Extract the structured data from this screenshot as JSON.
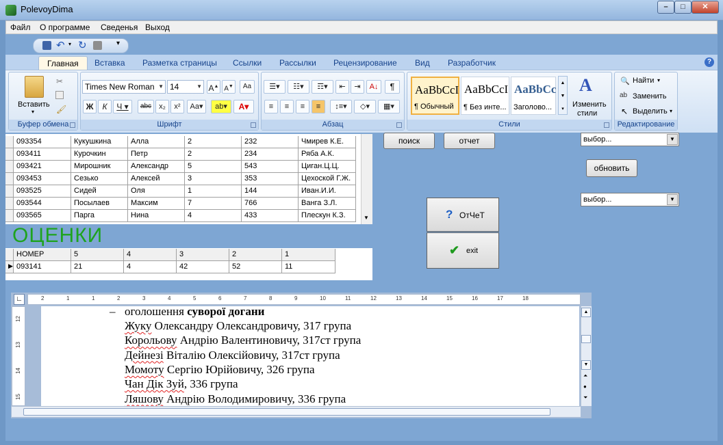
{
  "window": {
    "title": "PolevoyDima"
  },
  "menu": [
    "Файл",
    "О программе",
    "Сведенья",
    "Выход"
  ],
  "ribbon": {
    "tabs": [
      "Главная",
      "Вставка",
      "Разметка страницы",
      "Ссылки",
      "Рассылки",
      "Рецензирование",
      "Вид",
      "Разработчик"
    ],
    "clipboard": {
      "label": "Буфер обмена",
      "paste_label": "Вставить"
    },
    "font": {
      "label": "Шрифт",
      "family": "Times New Roman",
      "size": "14"
    },
    "paragraph": {
      "label": "Абзац"
    },
    "styles": {
      "label": "Стили",
      "items": [
        {
          "sample": "AaBbCcI",
          "name": "¶ Обычный"
        },
        {
          "sample": "AaBbCcI",
          "name": "¶ Без инте..."
        },
        {
          "sample": "AaBbCc",
          "name": "Заголово..."
        }
      ],
      "change_label": "Изменить",
      "change_label2": "стили"
    },
    "editing": {
      "label": "Редактирование",
      "find": "Найти",
      "replace": "Заменить",
      "select": "Выделить"
    }
  },
  "students": {
    "rows": [
      [
        "093354",
        "Кукушкина",
        "Алла",
        "2",
        "232",
        "Чмирев К.Е."
      ],
      [
        "093411",
        "Курочкин",
        "Петр",
        "2",
        "234",
        "Ряба А.К."
      ],
      [
        "093421",
        "Мирошник",
        "Александр",
        "5",
        "543",
        "Циган.Ц.Ц."
      ],
      [
        "093453",
        "Сезько",
        "Алексей",
        "3",
        "353",
        "Цехоской Г.Ж."
      ],
      [
        "093525",
        "Сидей",
        "Оля",
        "1",
        "144",
        "Иван.И.И."
      ],
      [
        "093544",
        "Посылаев",
        "Максим",
        "7",
        "766",
        "Ванга З.Л."
      ],
      [
        "093565",
        "Парга",
        "Нина",
        "4",
        "433",
        "Плескун К.З."
      ]
    ]
  },
  "grades": {
    "title": "ОЦЕНКИ",
    "headers": [
      "НОМЕР",
      "5",
      "4",
      "3",
      "2",
      "1"
    ],
    "rows": [
      [
        "093141",
        "21",
        "4",
        "42",
        "52",
        "11"
      ]
    ]
  },
  "controls": {
    "search": "поиск",
    "report": "отчет",
    "select1": "выбор...",
    "refresh": "обновить",
    "select2": "выбор...",
    "report2": "ОтЧеТ",
    "exit": "exit"
  },
  "ruler": {
    "ticks": [
      "2",
      "1",
      "1",
      "2",
      "3",
      "4",
      "5",
      "6",
      "7",
      "8",
      "9",
      "10",
      "11",
      "12",
      "13",
      "14",
      "15",
      "16",
      "17",
      "18"
    ],
    "vticks": [
      "12",
      "13",
      "14",
      "15"
    ]
  },
  "document": {
    "bullet": "–",
    "line1_normal": "оголошення ",
    "line1_bold": "суворої догани",
    "names": [
      {
        "name": "Жуку",
        "rest": " Олександру Олександровичу, 317 група"
      },
      {
        "name": "Корольову",
        "rest": " Андрію Валентиновичу, 317ст група"
      },
      {
        "name": "Дейнезі",
        "rest": " Віталію Олексійовичу, 317ст група"
      },
      {
        "name": "Момоту",
        "rest": " Сергію Юрійовичу, 326 група"
      },
      {
        "name": "Чан Дік Зуй",
        "rest": ", 336 група"
      },
      {
        "name": "Ляшову",
        "rest": " Андрію Володимировичу, 336 група"
      }
    ]
  },
  "colors": {
    "grades_title": "#1ea31e",
    "window_bg": "#7ea6d3",
    "check": "#1e9a1e",
    "question": "#1d5fc4"
  }
}
